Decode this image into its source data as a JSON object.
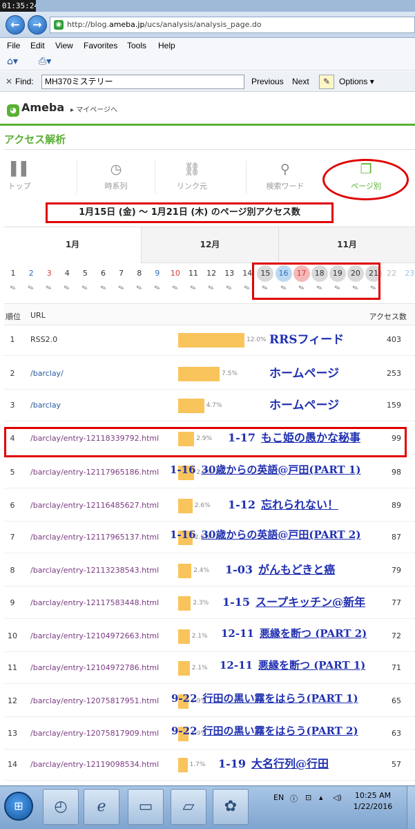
{
  "clock": "01:35:24",
  "browser": {
    "address_prefix": "http://blog.",
    "address_host": "ameba.jp",
    "address_rest": "/ucs/analysis/analysis_page.do",
    "menu": [
      "File",
      "Edit",
      "View",
      "Favorites",
      "Tools",
      "Help"
    ],
    "find_label": "Find:",
    "find_value": "MH370ミステリー",
    "find_previous": "Previous",
    "find_next": "Next",
    "find_options": "Options ▾"
  },
  "header": {
    "logo": "Ameba",
    "mypage": "▸ マイページへ"
  },
  "section_title": "アクセス解析",
  "tabs": [
    {
      "label": "トップ",
      "icon": "bar-chart-icon"
    },
    {
      "label": "時系列",
      "icon": "clock-icon"
    },
    {
      "label": "リンク元",
      "icon": "link-icon"
    },
    {
      "label": "検索ワード",
      "icon": "search-icon"
    },
    {
      "label": "ページ別",
      "icon": "pages-icon"
    }
  ],
  "period_title": "1月15日 (金) 〜 1月21日 (木) のページ別アクセス数",
  "months": [
    "1月",
    "12月",
    "11月"
  ],
  "days": [
    "1",
    "2",
    "3",
    "4",
    "5",
    "6",
    "7",
    "8",
    "9",
    "10",
    "11",
    "12",
    "13",
    "14",
    "15",
    "16",
    "17",
    "18",
    "19",
    "20",
    "21",
    "22",
    "23"
  ],
  "table_head": {
    "rank": "順位",
    "url": "URL",
    "count": "アクセス数"
  },
  "rows": [
    {
      "rank": "1",
      "url": "RSS2.0",
      "pct": "12.0%",
      "value": 12.0,
      "count": "403",
      "note": "RRSフィード"
    },
    {
      "rank": "2",
      "url": "/barclay/",
      "pct": "7.5%",
      "value": 7.5,
      "count": "253",
      "note": "ホームページ"
    },
    {
      "rank": "3",
      "url": "/barclay",
      "pct": "4.7%",
      "value": 4.7,
      "count": "159",
      "note": "ホームページ"
    },
    {
      "rank": "4",
      "url": "/barclay/entry-12118339792.html",
      "pct": "2.9%",
      "value": 2.9,
      "count": "99",
      "note_date": "1-17",
      "note": "もこ姫の愚かな秘事"
    },
    {
      "rank": "5",
      "url": "/barclay/entry-12117965186.html",
      "pct": "2.9%",
      "value": 2.9,
      "count": "98",
      "note_date": "1-16",
      "note": "30歳からの英語@戸田(PART 1)"
    },
    {
      "rank": "6",
      "url": "/barclay/entry-12116485627.html",
      "pct": "2.6%",
      "value": 2.6,
      "count": "89",
      "note_date": "1-12",
      "note": "忘れられない！"
    },
    {
      "rank": "7",
      "url": "/barclay/entry-12117965137.html",
      "pct": "2.6%",
      "value": 2.6,
      "count": "87",
      "note_date": "1-16",
      "note": "30歳からの英語@戸田(PART 2)"
    },
    {
      "rank": "8",
      "url": "/barclay/entry-12113238543.html",
      "pct": "2.4%",
      "value": 2.4,
      "count": "79",
      "note_date": "1-03",
      "note": "がんもどきと癌"
    },
    {
      "rank": "9",
      "url": "/barclay/entry-12117583448.html",
      "pct": "2.3%",
      "value": 2.3,
      "count": "77",
      "note_date": "1-15",
      "note": "スープキッチン@新年"
    },
    {
      "rank": "10",
      "url": "/barclay/entry-12104972663.html",
      "pct": "2.1%",
      "value": 2.1,
      "count": "72",
      "note_date": "12-11",
      "note": "悪縁を断つ (PART 2)"
    },
    {
      "rank": "11",
      "url": "/barclay/entry-12104972786.html",
      "pct": "2.1%",
      "value": 2.1,
      "count": "71",
      "note_date": "12-11",
      "note": "悪縁を断つ (PART 1)"
    },
    {
      "rank": "12",
      "url": "/barclay/entry-12075817951.html",
      "pct": "1.9%",
      "value": 1.9,
      "count": "65",
      "note_date": "9-22",
      "note": "行田の黒い霧をはらう(PART 1)"
    },
    {
      "rank": "13",
      "url": "/barclay/entry-12075817909.html",
      "pct": "1.9%",
      "value": 1.9,
      "count": "63",
      "note_date": "9-22",
      "note": "行田の黒い霧をはらう(PART 2)"
    },
    {
      "rank": "14",
      "url": "/barclay/entry-12119098534.html",
      "pct": "1.7%",
      "value": 1.7,
      "count": "57",
      "note_date": "1-19",
      "note": "大名行列@行田"
    }
  ],
  "taskbar": {
    "lang": "EN",
    "time": "10:25 AM",
    "date": "1/22/2016"
  }
}
